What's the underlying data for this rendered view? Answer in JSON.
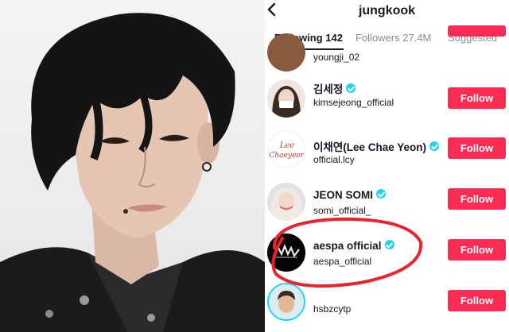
{
  "header": {
    "title": "jungkook",
    "back_icon": "chevron-left-icon"
  },
  "tabs": [
    {
      "label": "Following 142",
      "active": true
    },
    {
      "label": "Followers 27.4M",
      "active": false
    },
    {
      "label": "Suggested",
      "active": false
    }
  ],
  "following": [
    {
      "name": "",
      "username": "youngji_02",
      "verified": false,
      "button": ""
    },
    {
      "name": "김세정",
      "username": "kimsejeong_official",
      "verified": true,
      "button": "Follow"
    },
    {
      "name": "이채연(Lee Chae Yeon)",
      "username": "official.lcy",
      "verified": true,
      "button": "Follow"
    },
    {
      "name": "JEON SOMI",
      "username": "somi_official_",
      "verified": true,
      "button": "Follow"
    },
    {
      "name": "aespa official",
      "username": "aespa_official",
      "verified": true,
      "button": "Follow",
      "highlighted": true
    },
    {
      "name": "",
      "username": "hsbzcytp",
      "verified": false,
      "button": "Follow"
    }
  ],
  "avatar_logo_text": "Lee Chaeyeon",
  "colors": {
    "follow_button": "#fe2c55",
    "verified_badge": "#20d5ec",
    "highlight_circle": "#e8232c"
  }
}
